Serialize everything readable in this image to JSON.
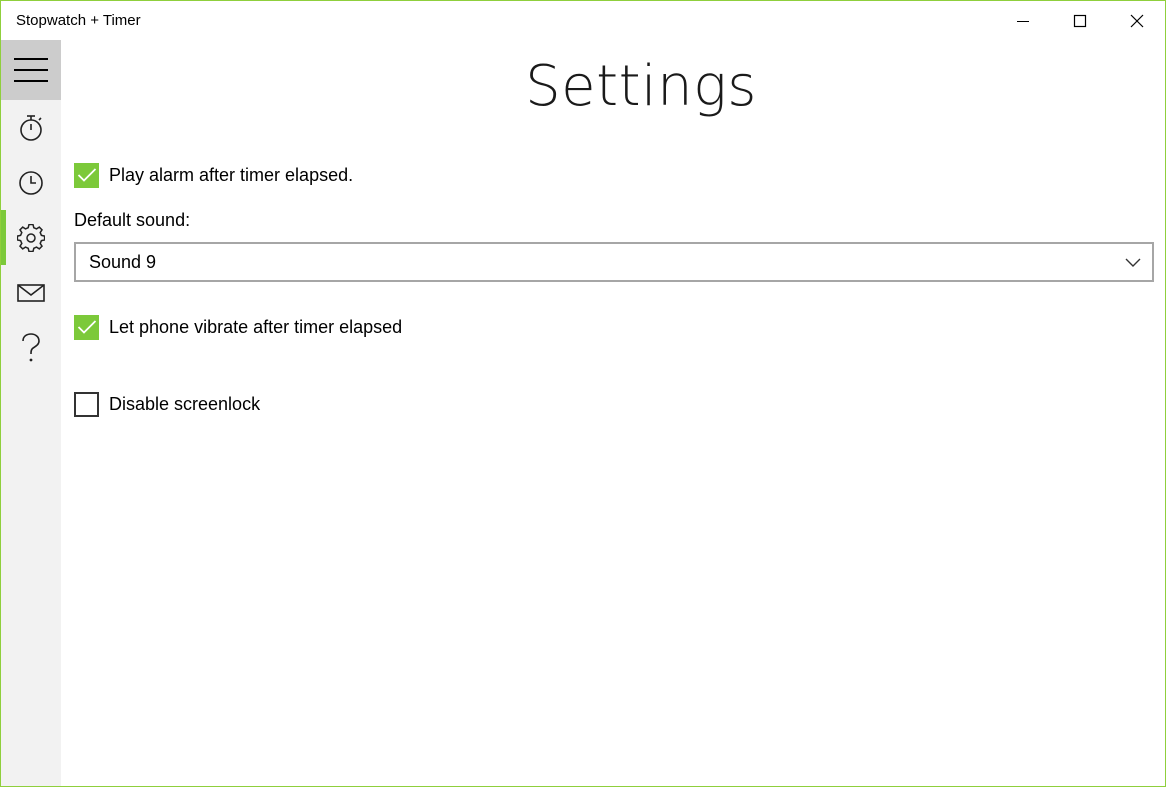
{
  "app": {
    "title": "Stopwatch + Timer"
  },
  "window_controls": {
    "minimize_icon": "minimize-icon",
    "maximize_icon": "maximize-icon",
    "close_icon": "close-icon"
  },
  "sidebar": {
    "items": [
      {
        "id": "menu",
        "icon": "hamburger-menu-icon",
        "active": false
      },
      {
        "id": "stopwatch",
        "icon": "stopwatch-icon",
        "active": false
      },
      {
        "id": "timer",
        "icon": "clock-icon",
        "active": false
      },
      {
        "id": "settings",
        "icon": "gear-icon",
        "active": true
      },
      {
        "id": "feedback",
        "icon": "mail-icon",
        "active": false
      },
      {
        "id": "help",
        "icon": "question-mark-icon",
        "active": false
      }
    ]
  },
  "settings": {
    "page_title": "Settings",
    "play_alarm": {
      "label": "Play alarm after timer elapsed.",
      "checked": true
    },
    "default_sound": {
      "label": "Default sound:",
      "value": "Sound 9"
    },
    "vibrate": {
      "label": "Let phone vibrate after timer elapsed",
      "checked": true
    },
    "disable_screenlock": {
      "label": "Disable screenlock",
      "checked": false
    }
  },
  "colors": {
    "accent": "#7cc93a",
    "window_border": "#8fcf3c",
    "sidebar_bg": "#f2f2f2",
    "hamburger_bg": "#cccccc"
  }
}
